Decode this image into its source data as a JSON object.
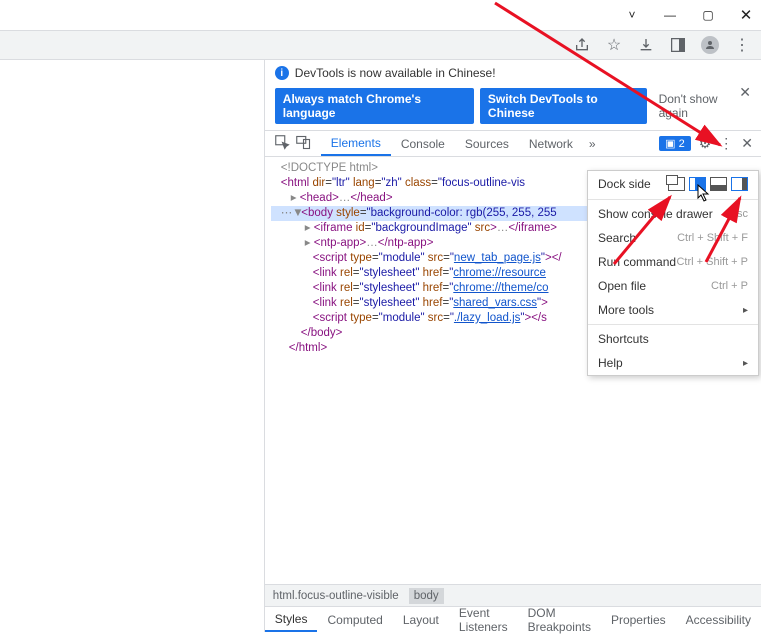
{
  "notification": {
    "text": "DevTools is now available in Chinese!",
    "btn_primary": "Always match Chrome's language",
    "btn_secondary": "Switch DevTools to Chinese",
    "btn_dismiss": "Don't show again"
  },
  "tabs": {
    "elements": "Elements",
    "console": "Console",
    "sources": "Sources",
    "network": "Network"
  },
  "messages_count": "2",
  "dom": {
    "doctype": "<!DOCTYPE html>",
    "html_open": {
      "dir": "ltr",
      "lang": "zh",
      "class": "focus-outline-vis"
    },
    "head": "<head>…</head>",
    "body_style": "background-color: rgb(255, 255, 255",
    "iframe_id": "backgroundImage",
    "ntp": "<ntp-app>…</ntp-app>",
    "script1_src": "new_tab_page.js",
    "link1_href": "chrome://resource",
    "link2_href": "chrome://theme/co",
    "link3_href": "shared_vars.css",
    "script2_src": "./lazy_load.js",
    "body_close": "</body>",
    "html_close": "</html>"
  },
  "breadcrumb": {
    "a": "html.focus-outline-visible",
    "b": "body"
  },
  "styles_tabs": [
    "Styles",
    "Computed",
    "Layout",
    "Event Listeners",
    "DOM Breakpoints",
    "Properties",
    "Accessibility"
  ],
  "menu": {
    "dock_label": "Dock side",
    "show_drawer": "Show console drawer",
    "show_drawer_sc": "Esc",
    "search": "Search",
    "search_sc": "Ctrl + Shift + F",
    "run_cmd": "Run command",
    "run_cmd_sc": "Ctrl + Shift + P",
    "open_file": "Open file",
    "open_file_sc": "Ctrl + P",
    "more_tools": "More tools",
    "shortcuts": "Shortcuts",
    "help": "Help"
  }
}
